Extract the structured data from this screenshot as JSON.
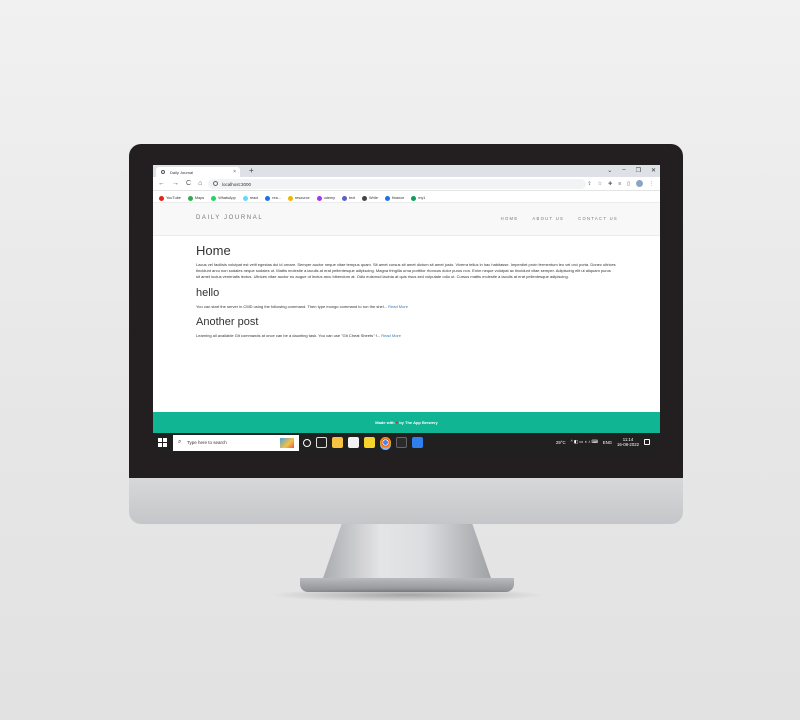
{
  "browser": {
    "tab_title": "Daily Journal",
    "tab_close": "×",
    "new_tab": "+",
    "window_controls": [
      "⌄",
      "–",
      "❐",
      "✕"
    ],
    "nav": [
      "←",
      "→",
      "C",
      "⌂"
    ],
    "url": "localhost:3000",
    "addr_icons": [
      "⇪",
      "☆",
      "✚",
      "≡",
      "▯"
    ],
    "menu": "⋮",
    "bookmarks": [
      {
        "label": "YouTube",
        "color": "#e62117"
      },
      {
        "label": "Maps",
        "color": "#34a853"
      },
      {
        "label": "WhatsApp",
        "color": "#25d366"
      },
      {
        "label": "react",
        "color": "#61dafb"
      },
      {
        "label": "rea...",
        "color": "#1a73e8"
      },
      {
        "label": "resource",
        "color": "#f4b400"
      },
      {
        "label": "udemy",
        "color": "#a435f0"
      },
      {
        "label": "text",
        "color": "#5b5fc7"
      },
      {
        "label": "Write",
        "color": "#444444"
      },
      {
        "label": "finance",
        "color": "#1a73e8"
      },
      {
        "label": "my1",
        "color": "#0f9d58"
      }
    ]
  },
  "site": {
    "brand": "DAILY JOURNAL",
    "nav": [
      "HOME",
      "ABOUT US",
      "CONTACT US"
    ],
    "home_title": "Home",
    "home_text": "Lacus vel facilisis volutpat est velit egestas dui id ornare. Semper auctor neque vitae tempus quam. Sit amet cursus sit amet dictum sit amet justo. Viverra tellus in hac habitasse. Imperdiet proin fermentum leo vel orci porta. Donec ultrices tincidunt arcu non sodales neque sodales ut. Mattis molestie a iaculis at erat pellentesque adipiscing. Magna fringilla urna porttitor rhoncus dolor purus non. Enim neque volutpat ac tincidunt vitae semper. Adipiscing elit ut aliquam purus sit amet luctus venenatis lectus. Ultrices vitae auctor eu augue ut lectus arcu bibendum at. Odio euismod lacinia at quis risus sed vulputate odio ut. Cursus mattis molestie a iaculis at erat pellentesque adipiscing.",
    "posts": [
      {
        "title": "hello",
        "excerpt": "You can start the server in CMD using the following command. Then type mongo command to run the shel...",
        "link": "Read More"
      },
      {
        "title": "Another post",
        "excerpt": "Learning all available Git commands at once can be a daunting task. You can use \"Git Cheat Sheets\" f...",
        "link": "Read More"
      }
    ],
    "footer_prefix": "Made with",
    "footer_heart": "♥",
    "footer_suffix": "by The App Brewery"
  },
  "taskbar": {
    "search_placeholder": "Type here to search",
    "search_glyph": "⌕",
    "apps": [
      {
        "name": "cortana",
        "color": "#ffffff"
      },
      {
        "name": "task-view",
        "color": "#dddddd"
      },
      {
        "name": "file-explorer",
        "color": "#f5c242"
      },
      {
        "name": "store",
        "color": "#f2f2f2"
      },
      {
        "name": "sticky-notes",
        "color": "#f6d32d"
      },
      {
        "name": "chrome",
        "color": "#4285f4"
      },
      {
        "name": "terminal",
        "color": "#2b2b2b"
      },
      {
        "name": "vscode",
        "color": "#2f80ed"
      }
    ],
    "weather": "29°C",
    "tray_icons": "^ ◧ ▭ ◖ ♪ ⌨",
    "language": "ENG",
    "time": "11:14",
    "date": "16-08-2022"
  }
}
